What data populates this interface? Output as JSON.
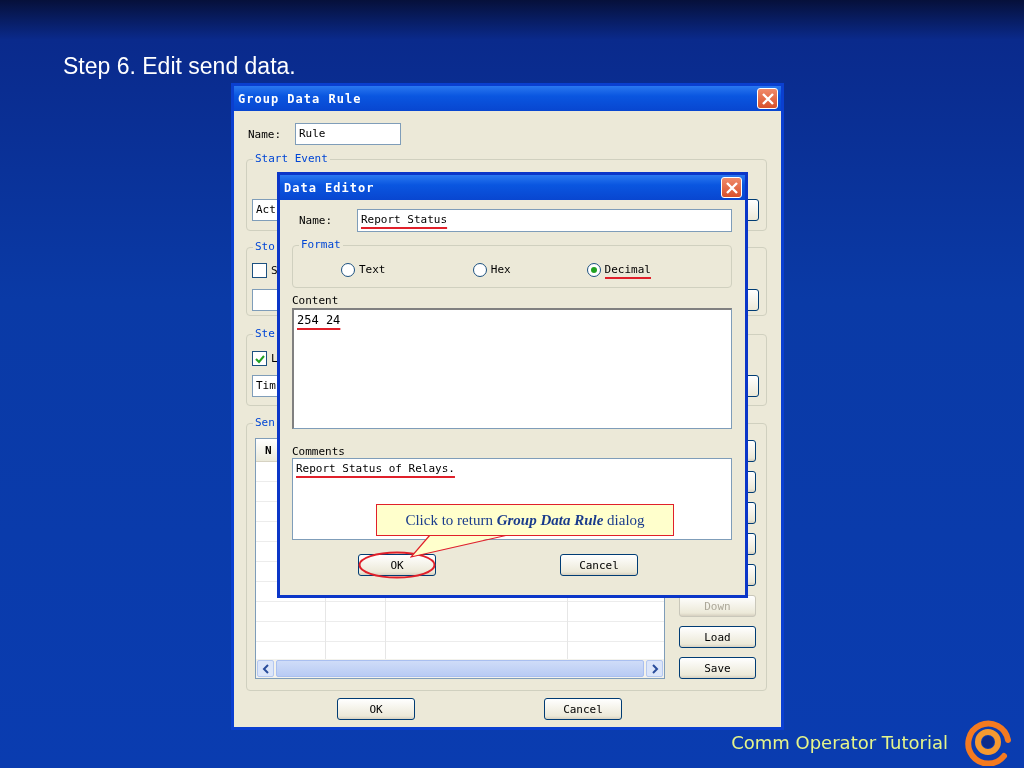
{
  "slide_title": "Step 6. Edit send data.",
  "group_data_rule": {
    "title": "Group Data Rule",
    "name_label": "Name:",
    "name_value": "Rule",
    "start_event": {
      "label": "Start Event",
      "field_value": "Act"
    },
    "stop_event": {
      "label": "Sto",
      "checkbox": {
        "label": "S",
        "checked": false
      }
    },
    "step": {
      "label": "Ste",
      "checkbox": {
        "label": "L",
        "checked": true
      },
      "field_value": "Tim"
    },
    "send": {
      "label": "Sen",
      "table": {
        "columns": [
          "N"
        ]
      },
      "buttons": [
        {
          "label": "Down",
          "disabled": true
        },
        {
          "label": "Load",
          "disabled": false
        },
        {
          "label": "Save",
          "disabled": false
        }
      ]
    },
    "buttons": [
      {
        "label": "OK"
      },
      {
        "label": "Cancel"
      }
    ]
  },
  "data_editor": {
    "title": "Data Editor",
    "name_label": "Name:",
    "name_value": "Report Status",
    "name_underlined": true,
    "format": {
      "label": "Format",
      "options": [
        {
          "label": "Text",
          "selected": false,
          "underlined": false
        },
        {
          "label": "Hex",
          "selected": false,
          "underlined": false
        },
        {
          "label": "Decimal",
          "selected": true,
          "underlined": true
        }
      ]
    },
    "content_label": "Content",
    "content": "254 24",
    "content_underlined": true,
    "comments_label": "Comments",
    "comments": "Report Status of Relays.",
    "comments_underlined": true,
    "buttons": [
      {
        "label": "OK",
        "circled": true
      },
      {
        "label": "Cancel",
        "circled": false
      }
    ]
  },
  "callout": "Click to return **Group Data Rule** dialog",
  "footer": "Comm Operator Tutorial"
}
